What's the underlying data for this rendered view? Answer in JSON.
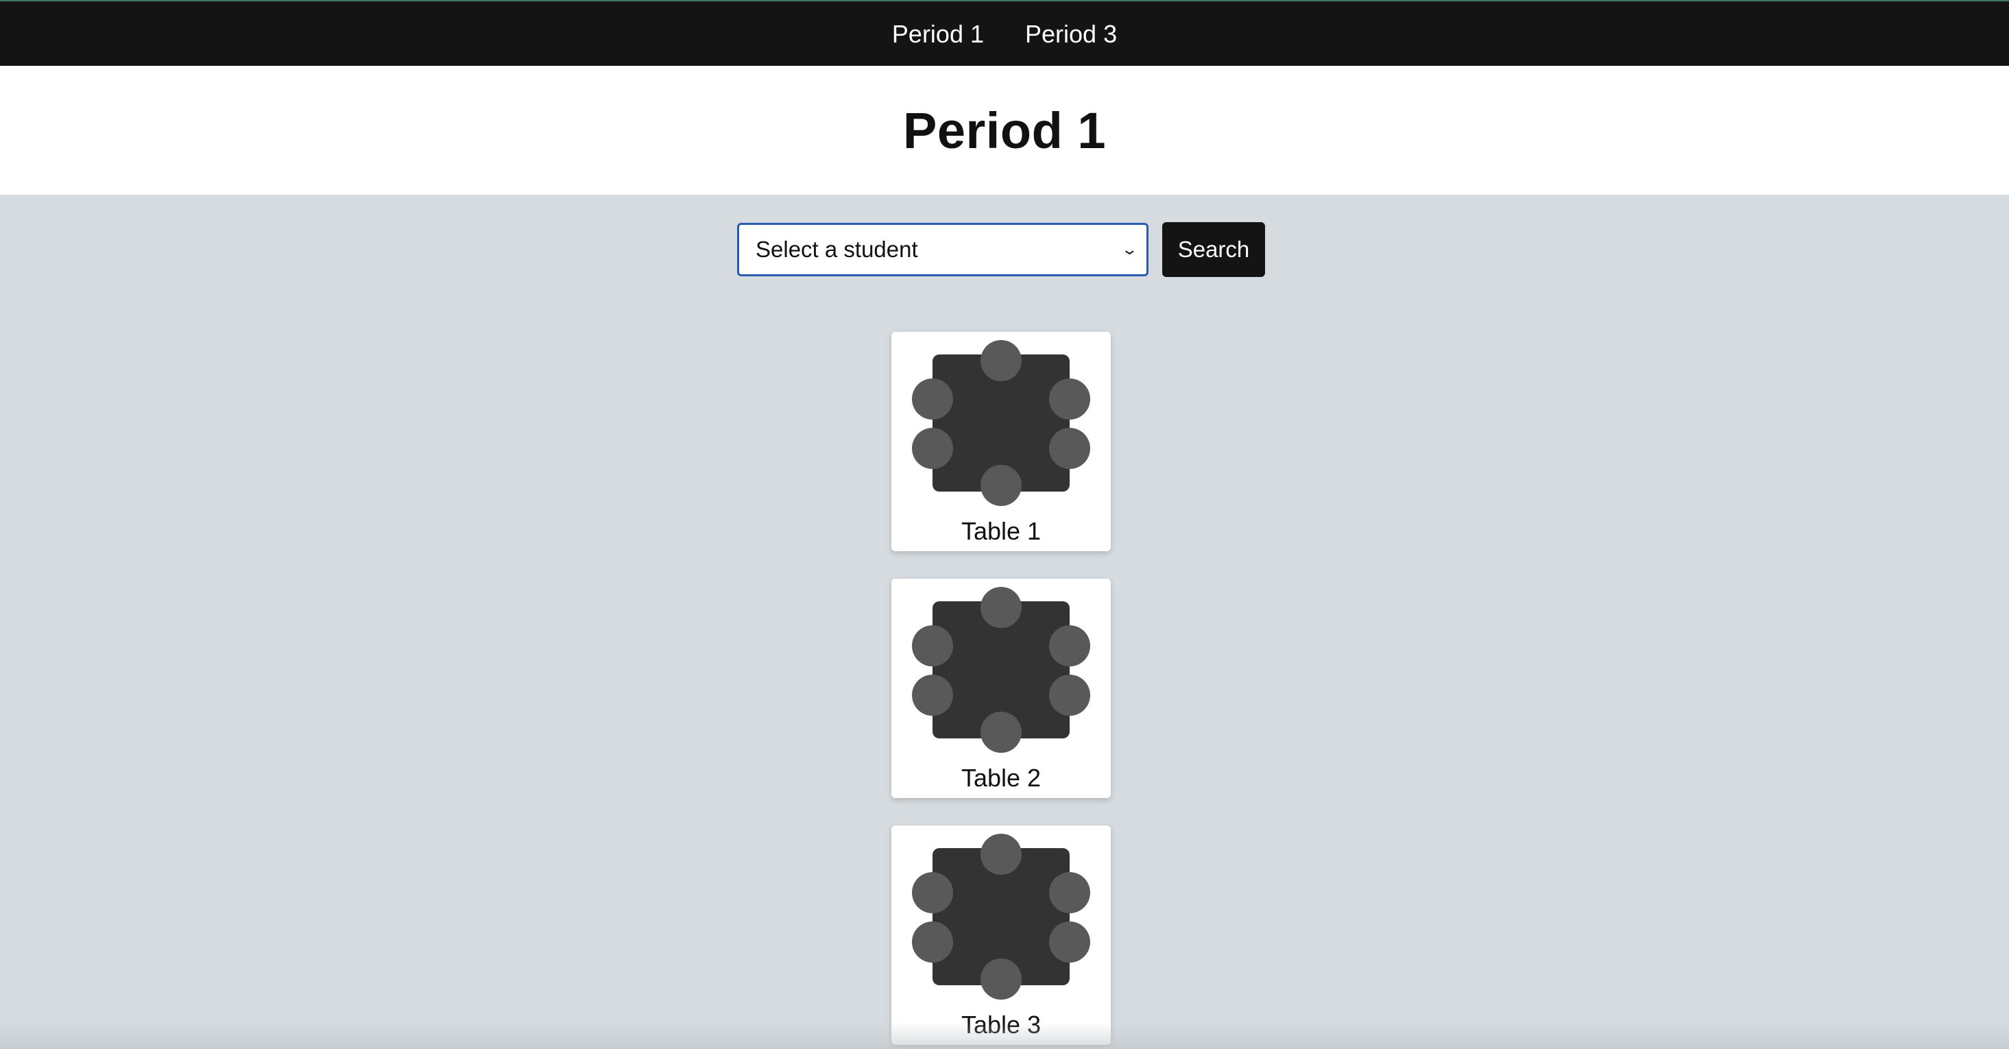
{
  "nav": {
    "links": [
      {
        "label": "Period 1"
      },
      {
        "label": "Period 3"
      }
    ]
  },
  "header": {
    "title": "Period 1"
  },
  "search": {
    "select_value": "Select a student",
    "button_label": "Search"
  },
  "tables": [
    {
      "label": "Table 1"
    },
    {
      "label": "Table 2"
    },
    {
      "label": "Table 3"
    }
  ],
  "colors": {
    "nav_bg": "#141414",
    "page_bg": "#d5dbdf",
    "table_top": "#333333",
    "seat": "#595959",
    "select_border": "#2a5db0"
  }
}
